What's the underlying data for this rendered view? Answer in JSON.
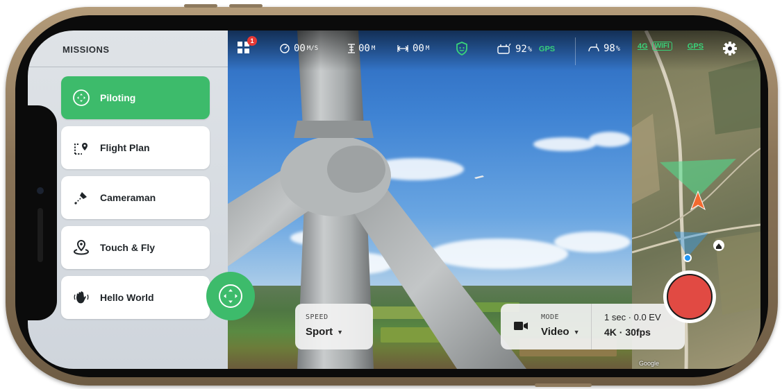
{
  "missions": {
    "title": "MISSIONS",
    "items": [
      {
        "label": "Piloting",
        "icon": "piloting-icon",
        "active": true
      },
      {
        "label": "Flight Plan",
        "icon": "flight-plan-icon",
        "active": false
      },
      {
        "label": "Cameraman",
        "icon": "cameraman-icon",
        "active": false
      },
      {
        "label": "Touch & Fly",
        "icon": "touch-fly-icon",
        "active": false
      },
      {
        "label": "Hello World",
        "icon": "hello-world-icon",
        "active": false
      }
    ]
  },
  "telemetry": {
    "notification_count": "1",
    "speed_value": "00",
    "speed_unit": "M/S",
    "altitude_value": "00",
    "altitude_unit": "M",
    "distance_value": "00",
    "distance_unit": "M",
    "drone_battery": "92",
    "drone_battery_unit": "%",
    "drone_gps_label": "GPS",
    "controller_battery": "98",
    "controller_battery_unit": "%",
    "network_label": "4G",
    "wifi_label": "WIFI",
    "phone_gps_label": "GPS"
  },
  "controls": {
    "speed_label": "SPEED",
    "speed_value": "Sport",
    "mode_label": "MODE",
    "mode_value": "Video",
    "exposure": "1 sec · 0.0 EV",
    "resolution": "4K · 30fps"
  },
  "map": {
    "attribution": "Google"
  },
  "colors": {
    "accent_green": "#3dbb6b",
    "record_red": "#e14a43",
    "badge_red": "#e53935",
    "gps_green": "#39d37a"
  }
}
